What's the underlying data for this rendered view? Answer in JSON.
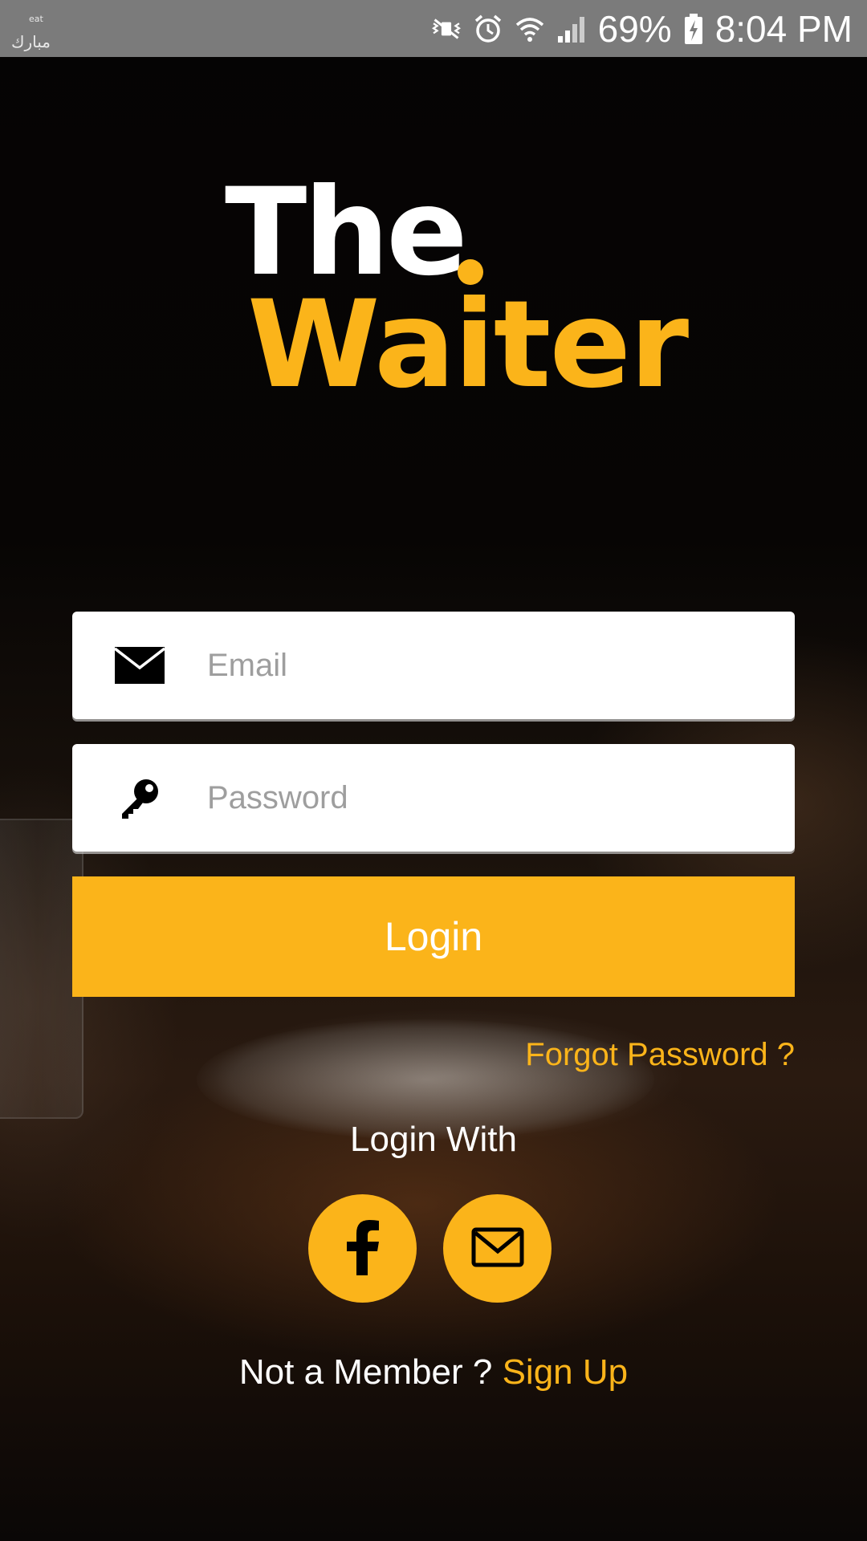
{
  "status_bar": {
    "carrier_text": "مبارك",
    "carrier_sub": "eat",
    "battery": "69%",
    "time": "8:04 PM",
    "icons": [
      "vibrate-mute-icon",
      "alarm-icon",
      "wifi-icon",
      "signal-icon",
      "battery-charging-icon"
    ]
  },
  "logo": {
    "line1": "The",
    "line2": "Waiter"
  },
  "form": {
    "email_placeholder": "Email",
    "email_value": "",
    "password_placeholder": "Password",
    "password_value": "",
    "login_label": "Login",
    "forgot_label": "Forgot Password ?"
  },
  "social": {
    "heading": "Login With",
    "facebook_glyph": "f"
  },
  "footer": {
    "prompt": "Not a Member ?",
    "signup_label": "Sign Up"
  },
  "colors": {
    "accent": "#fbb41a",
    "status_bar": "#7b7b7b",
    "field_bg": "#ffffff",
    "text_light": "#ffffff"
  }
}
